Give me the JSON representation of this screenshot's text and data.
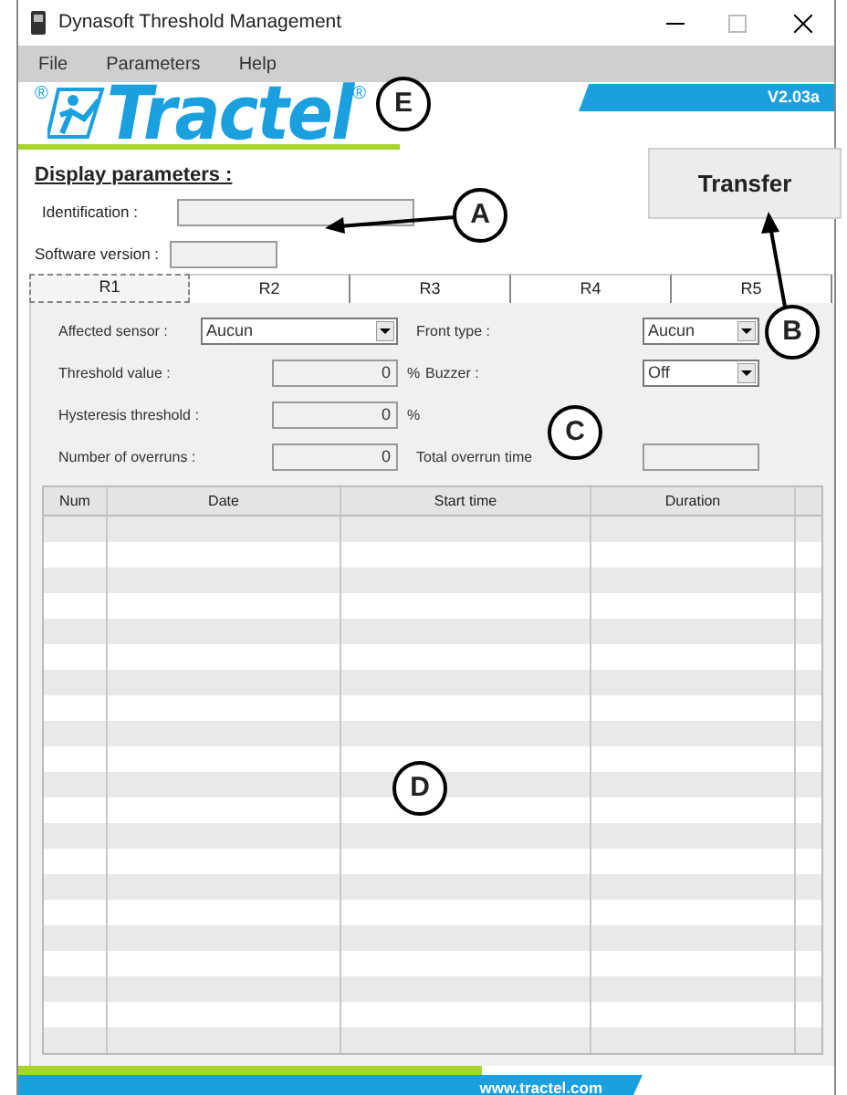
{
  "window": {
    "title": "Dynasoft Threshold Management"
  },
  "menu": [
    "File",
    "Parameters",
    "Help"
  ],
  "logo": {
    "text": "Tractel",
    "mark": "®"
  },
  "version": "V2.03a",
  "transfer_button": "Transfer",
  "display_parameters": {
    "heading": "Display parameters :",
    "fields": [
      {
        "label": "Identification :"
      },
      {
        "label": "Software version :"
      }
    ]
  },
  "tabs": [
    {
      "label": "R1",
      "selected": true
    },
    {
      "label": "R2",
      "selected": false
    },
    {
      "label": "R3",
      "selected": false
    },
    {
      "label": "R4",
      "selected": false
    },
    {
      "label": "R5",
      "selected": false
    }
  ],
  "form": {
    "affected_sensor": {
      "label": "Affected sensor :",
      "value": "Aucun"
    },
    "front_type": {
      "label": "Front type :",
      "value": "Aucun"
    },
    "threshold_value": {
      "label": "Threshold value :",
      "value": "0",
      "unit": "%"
    },
    "buzzer": {
      "label": "Buzzer :",
      "value": "Off"
    },
    "hysteresis_threshold": {
      "label": "Hysteresis threshold :",
      "value": "0",
      "unit": "%"
    },
    "number_of_overruns": {
      "label": "Number of overruns :",
      "value": "0"
    },
    "total_overrun_time": {
      "label": "Total overrun time"
    }
  },
  "table": {
    "columns": [
      "Num",
      "Date",
      "Start time",
      "Duration"
    ]
  },
  "footer": "www.tractel.com",
  "callouts": [
    "A",
    "B",
    "C",
    "D",
    "E"
  ]
}
